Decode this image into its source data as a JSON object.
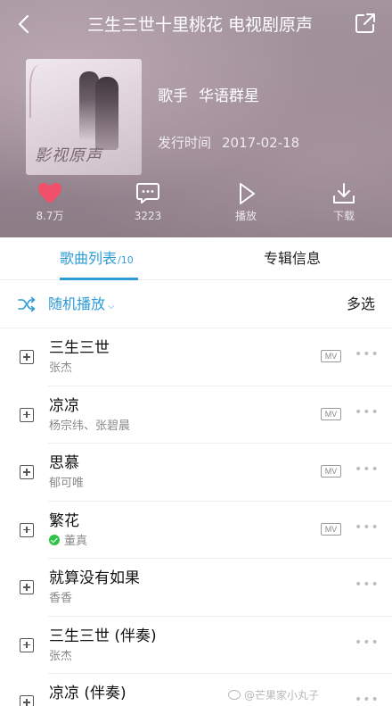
{
  "header": {
    "title": "三生三世十里桃花 电视剧原声",
    "singer_label": "歌手",
    "singer_name": "华语群星",
    "release_label": "发行时间",
    "release_date": "2017-02-18",
    "cover_logo_text": "影视原声",
    "actions": [
      {
        "id": "like",
        "icon": "heart-icon",
        "label": "8.7万",
        "color": "#f2506a"
      },
      {
        "id": "comment",
        "icon": "comment-icon",
        "label": "3223"
      },
      {
        "id": "play",
        "icon": "play-icon",
        "label": "播放"
      },
      {
        "id": "download",
        "icon": "download-icon",
        "label": "下载"
      }
    ]
  },
  "tabs": [
    {
      "label": "歌曲列表",
      "count": "/10",
      "active": true
    },
    {
      "label": "专辑信息",
      "active": false
    }
  ],
  "toolbar": {
    "shuffle_label": "随机播放",
    "multi_select_label": "多选"
  },
  "songs": [
    {
      "name": "三生三世",
      "artist": "张杰",
      "mv": "MV",
      "verified": false
    },
    {
      "name": "凉凉",
      "artist": "杨宗纬、张碧晨",
      "mv": "MV",
      "verified": false
    },
    {
      "name": "思慕",
      "artist": "郁可唯",
      "mv": "MV",
      "verified": false
    },
    {
      "name": "繁花",
      "artist": "董真",
      "mv": "MV",
      "verified": true
    },
    {
      "name": "就算没有如果",
      "artist": "香香",
      "mv": "",
      "verified": false
    },
    {
      "name": "三生三世 (伴奏)",
      "artist": "张杰",
      "mv": "",
      "verified": false
    },
    {
      "name": "凉凉 (伴奏)",
      "artist": "",
      "mv": "",
      "verified": false
    }
  ],
  "watermark": "@芒果家小丸子",
  "colors": {
    "accent": "#2d9bd6",
    "like": "#f2506a",
    "verified": "#31c24a"
  }
}
